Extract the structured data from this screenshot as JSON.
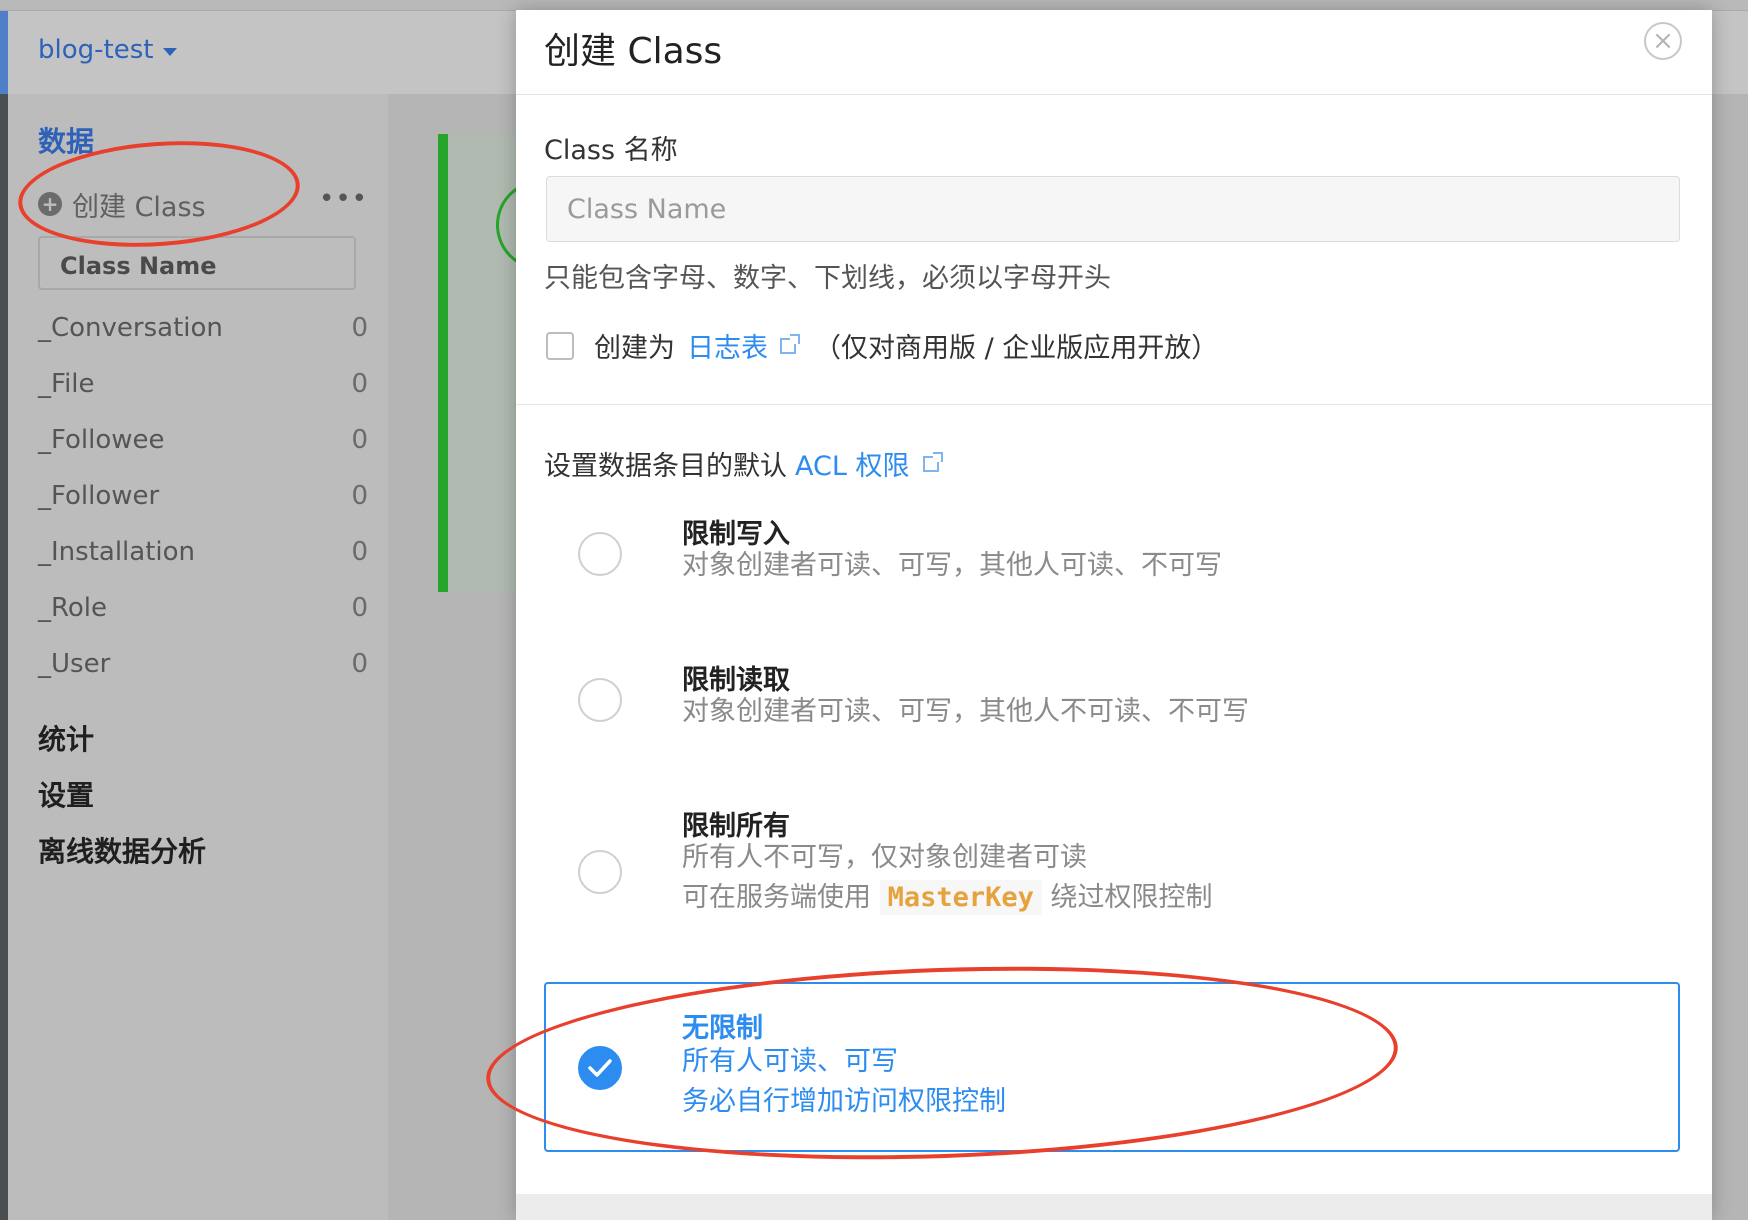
{
  "app": {
    "name": "blog-test"
  },
  "sidebar": {
    "data_section": "数据",
    "create_class_label": "创建 Class",
    "class_name_placeholder": "Class Name",
    "classes": [
      {
        "name": "_Conversation",
        "count": "0"
      },
      {
        "name": "_File",
        "count": "0"
      },
      {
        "name": "_Followee",
        "count": "0"
      },
      {
        "name": "_Follower",
        "count": "0"
      },
      {
        "name": "_Installation",
        "count": "0"
      },
      {
        "name": "_Role",
        "count": "0"
      },
      {
        "name": "_User",
        "count": "0"
      }
    ],
    "stats_section": "统计",
    "settings_section": "设置",
    "offline_section": "离线数据分析"
  },
  "modal": {
    "title": "创建 Class",
    "name_label": "Class 名称",
    "name_placeholder": "Class Name",
    "name_value": "",
    "hint": "只能包含字母、数字、下划线，必须以字母开头",
    "log_prefix": "创建为",
    "log_link": "日志表",
    "log_suffix": "（仅对商用版 / 企业版应用开放）",
    "acl_prefix": "设置数据条目的默认",
    "acl_link": "ACL 权限",
    "options": [
      {
        "title": "限制写入",
        "desc1": "对象创建者可读、可写，其他人可读、不可写",
        "selected": false
      },
      {
        "title": "限制读取",
        "desc1": "对象创建者可读、可写，其他人不可读、不可写",
        "selected": false
      },
      {
        "title": "限制所有",
        "desc1": "所有人不可写，仅对象创建者可读",
        "desc2_pre": "可在服务端使用",
        "desc2_code": "MasterKey",
        "desc2_post": "绕过权限控制",
        "selected": false
      },
      {
        "title": "无限制",
        "desc1": "所有人可读、可写",
        "desc2": "务必自行增加访问权限控制",
        "selected": true
      }
    ]
  },
  "colors": {
    "accent": "#2d8cf0",
    "annotation": "#e8402d",
    "success": "#25a52a"
  }
}
